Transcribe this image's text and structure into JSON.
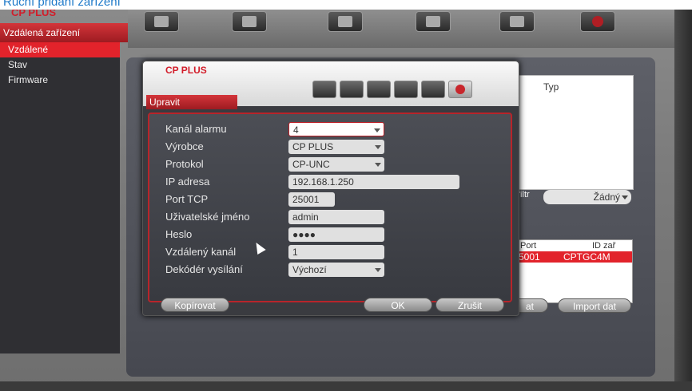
{
  "caption": "Ruční přidání zařízení",
  "app": {
    "logo": "CP PLUS",
    "side_title": "Vzdálená zařízení"
  },
  "sidebar": {
    "items": [
      {
        "label": "Vzdálené",
        "active": true
      },
      {
        "label": "Stav",
        "active": false
      },
      {
        "label": "Firmware",
        "active": false
      }
    ]
  },
  "toolbar": {
    "icons": [
      "camera-icon",
      "network-icon",
      "list-icon",
      "monitor-icon",
      "wrench-icon",
      "power-icon"
    ]
  },
  "background_panel": {
    "typ_label": "Typ",
    "filter_label": "filtr",
    "filter_value": "Žádný",
    "table_headers": [
      "Port",
      "ID zař"
    ],
    "table_row": [
      "5001",
      "CPTGC4M"
    ],
    "btn_export": "at",
    "btn_import": "Import dat"
  },
  "dialog": {
    "logo": "CP PLUS",
    "title": "Upravit",
    "icons": [
      "camera-icon",
      "network-icon",
      "list-icon",
      "monitor-icon",
      "wrench-icon",
      "power-icon"
    ],
    "fields": {
      "alarm_channel": {
        "label": "Kanál alarmu",
        "value": "4"
      },
      "manufacturer": {
        "label": "Výrobce",
        "value": "CP PLUS"
      },
      "protocol": {
        "label": "Protokol",
        "value": "CP-UNC"
      },
      "ip": {
        "label": "IP adresa",
        "value": "192.168.1.250"
      },
      "port": {
        "label": "Port TCP",
        "value": "25001"
      },
      "username": {
        "label": "Uživatelské jméno",
        "value": "admin"
      },
      "password": {
        "label": "Heslo",
        "value": "●●●●"
      },
      "remote_channel": {
        "label": "Vzdálený kanál",
        "value": "1"
      },
      "decoder": {
        "label": "Dekódér vysílání",
        "value": "Výchozí"
      }
    },
    "btn_copy": "Kopírovat",
    "btn_ok": "OK",
    "btn_cancel": "Zrušit"
  },
  "colors": {
    "accent": "#e2232b",
    "sidebar": "#2f2f33",
    "dialog_bg": "#3a3b40"
  }
}
